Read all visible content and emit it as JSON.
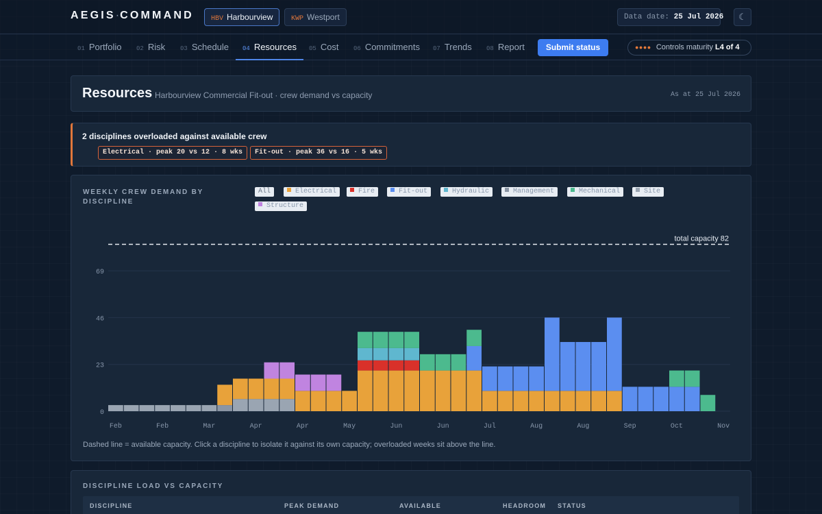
{
  "app": {
    "brand_main": "AEGIS",
    "brand_sep": "·",
    "brand_tail": "COMMAND",
    "projects": [
      {
        "code": "HBV",
        "name": "Harbourview",
        "active": true
      },
      {
        "code": "KWP",
        "name": "Westport",
        "active": false
      }
    ],
    "data_date_label": "Data date:",
    "data_date_value": "25 Jul 2026",
    "theme_icon": "☾"
  },
  "nav": {
    "tabs": [
      {
        "num": "01",
        "label": "Portfolio"
      },
      {
        "num": "02",
        "label": "Risk"
      },
      {
        "num": "03",
        "label": "Schedule"
      },
      {
        "num": "04",
        "label": "Resources",
        "active": true
      },
      {
        "num": "05",
        "label": "Cost"
      },
      {
        "num": "06",
        "label": "Commitments"
      },
      {
        "num": "07",
        "label": "Trends"
      },
      {
        "num": "08",
        "label": "Report"
      }
    ],
    "submit_label": "Submit status",
    "maturity_dots": "●●●●",
    "maturity_label": "Controls maturity",
    "maturity_value": "L4 of 4"
  },
  "header": {
    "title": "Resources",
    "subtitle": "Harbourview Commercial Fit-out · crew demand vs capacity",
    "as_at": "As at 25 Jul 2026"
  },
  "alert": {
    "title": "2 disciplines overloaded against available crew",
    "pills": [
      "Electrical · peak 20 vs 12 · 8 wks",
      "Fit-out · peak 36 vs 16 · 5 wks"
    ]
  },
  "chart_section": {
    "label_line1": "WEEKLY CREW DEMAND BY",
    "label_line2": "DISCIPLINE",
    "legend": [
      {
        "label": "All",
        "color": ""
      },
      {
        "label": "Electrical",
        "color": "#e8a23a"
      },
      {
        "label": "Fire",
        "color": "#d9312a"
      },
      {
        "label": "Fit-out",
        "color": "#5b8ef0"
      },
      {
        "label": "Hydraulic",
        "color": "#5fb7cf"
      },
      {
        "label": "Management",
        "color": "#8a95a4"
      },
      {
        "label": "Mechanical",
        "color": "#4cba8e"
      },
      {
        "label": "Site",
        "color": "#9aa5b2"
      },
      {
        "label": "Structure",
        "color": "#c084e0"
      }
    ],
    "note": "Dashed line = available capacity. Click a discipline to isolate it against its own capacity; overloaded weeks sit above the line."
  },
  "chart_data": {
    "type": "bar",
    "stacked": true,
    "capacity_label": "total capacity 82",
    "capacity": 82,
    "ylim": [
      0,
      85
    ],
    "yticks": [
      0,
      23,
      46,
      69
    ],
    "xtick_labels": [
      "Feb",
      "Feb",
      "Mar",
      "Apr",
      "Apr",
      "May",
      "Jun",
      "Jun",
      "Jul",
      "Aug",
      "Aug",
      "Sep",
      "Oct",
      "Nov"
    ],
    "weeks": 40,
    "series": [
      {
        "name": "Site",
        "color": "#9aa5b2",
        "values": [
          3,
          3,
          3,
          3,
          3,
          3,
          3,
          0,
          6,
          6,
          6,
          6,
          0,
          0,
          0,
          0,
          0,
          0,
          0,
          0,
          0,
          0,
          0,
          0,
          0,
          0,
          0,
          0,
          0,
          0,
          0,
          0,
          0,
          0,
          0,
          0,
          0,
          0,
          0,
          0
        ]
      },
      {
        "name": "Management",
        "color": "#8a95a4",
        "values": [
          0,
          0,
          0,
          0,
          0,
          0,
          0,
          3,
          0,
          0,
          0,
          0,
          0,
          0,
          0,
          0,
          0,
          0,
          0,
          0,
          0,
          0,
          0,
          0,
          0,
          0,
          0,
          0,
          0,
          0,
          0,
          0,
          0,
          0,
          0,
          0,
          0,
          0,
          0,
          0
        ]
      },
      {
        "name": "Electrical",
        "color": "#e8a23a",
        "values": [
          0,
          0,
          0,
          0,
          0,
          0,
          0,
          10,
          10,
          10,
          10,
          10,
          10,
          10,
          10,
          10,
          20,
          20,
          20,
          20,
          20,
          20,
          20,
          20,
          10,
          10,
          10,
          10,
          10,
          10,
          10,
          10,
          10,
          0,
          0,
          0,
          0,
          0,
          0,
          0
        ]
      },
      {
        "name": "Fire",
        "color": "#d9312a",
        "values": [
          0,
          0,
          0,
          0,
          0,
          0,
          0,
          0,
          0,
          0,
          0,
          0,
          0,
          0,
          0,
          0,
          5,
          5,
          5,
          5,
          0,
          0,
          0,
          0,
          0,
          0,
          0,
          0,
          0,
          0,
          0,
          0,
          0,
          0,
          0,
          0,
          0,
          0,
          0,
          0
        ]
      },
      {
        "name": "Fit-out",
        "color": "#5b8ef0",
        "values": [
          0,
          0,
          0,
          0,
          0,
          0,
          0,
          0,
          0,
          0,
          0,
          0,
          0,
          0,
          0,
          0,
          0,
          0,
          0,
          0,
          0,
          0,
          0,
          12,
          12,
          12,
          12,
          12,
          36,
          24,
          24,
          24,
          36,
          12,
          12,
          12,
          12,
          12,
          0,
          0
        ]
      },
      {
        "name": "Hydraulic",
        "color": "#5fb7cf",
        "values": [
          0,
          0,
          0,
          0,
          0,
          0,
          0,
          0,
          0,
          0,
          0,
          0,
          0,
          0,
          0,
          0,
          6,
          6,
          6,
          6,
          0,
          0,
          0,
          0,
          0,
          0,
          0,
          0,
          0,
          0,
          0,
          0,
          0,
          0,
          0,
          0,
          0,
          0,
          0,
          0
        ]
      },
      {
        "name": "Mechanical",
        "color": "#4cba8e",
        "values": [
          0,
          0,
          0,
          0,
          0,
          0,
          0,
          0,
          0,
          0,
          0,
          0,
          0,
          0,
          0,
          0,
          8,
          8,
          8,
          8,
          8,
          8,
          8,
          8,
          0,
          0,
          0,
          0,
          0,
          0,
          0,
          0,
          0,
          0,
          0,
          0,
          8,
          8,
          8,
          0
        ]
      },
      {
        "name": "Structure",
        "color": "#c084e0",
        "values": [
          0,
          0,
          0,
          0,
          0,
          0,
          0,
          0,
          0,
          0,
          8,
          8,
          8,
          8,
          8,
          0,
          0,
          0,
          0,
          0,
          0,
          0,
          0,
          0,
          0,
          0,
          0,
          0,
          0,
          0,
          0,
          0,
          0,
          0,
          0,
          0,
          0,
          0,
          0,
          0
        ]
      }
    ]
  },
  "table": {
    "label": "DISCIPLINE LOAD VS CAPACITY",
    "columns": [
      "DISCIPLINE",
      "PEAK DEMAND",
      "AVAILABLE",
      "HEADROOM",
      "STATUS"
    ]
  }
}
